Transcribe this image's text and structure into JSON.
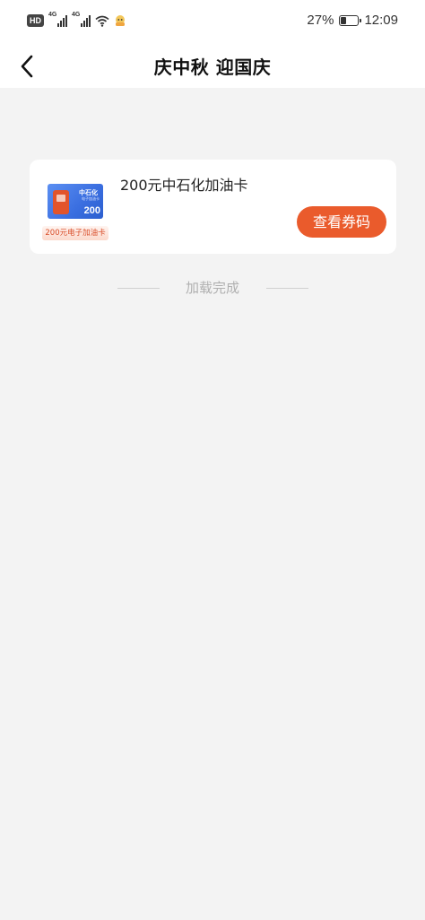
{
  "status_bar": {
    "hd_label": "HD",
    "network_labels": [
      "4G",
      "4G"
    ],
    "battery_percent": "27%",
    "battery_level": 0.27,
    "time": "12:09",
    "icons": [
      "hd-icon",
      "signal-icon",
      "signal-icon",
      "wifi-icon",
      "app-notification-icon",
      "battery-icon"
    ]
  },
  "nav": {
    "back_icon": "chevron-left-icon",
    "title": "庆中秋 迎国庆"
  },
  "coupon": {
    "thumb_brand": "中石化",
    "thumb_subtitle": "电子加油卡",
    "thumb_amount": "200",
    "thumb_tag": "200元电子加油卡",
    "name": "200元中石化加油卡",
    "button_label": "查看券码",
    "accent_color": "#ea5b2c"
  },
  "list_footer": {
    "text": "加载完成"
  }
}
